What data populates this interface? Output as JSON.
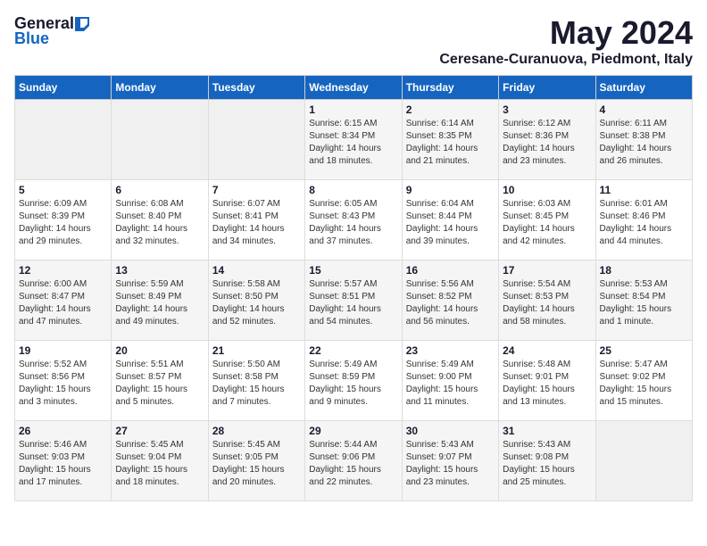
{
  "logo": {
    "general": "General",
    "blue": "Blue"
  },
  "title": "May 2024",
  "location": "Ceresane-Curanuova, Piedmont, Italy",
  "weekdays": [
    "Sunday",
    "Monday",
    "Tuesday",
    "Wednesday",
    "Thursday",
    "Friday",
    "Saturday"
  ],
  "weeks": [
    [
      {
        "day": null,
        "info": ""
      },
      {
        "day": null,
        "info": ""
      },
      {
        "day": null,
        "info": ""
      },
      {
        "day": "1",
        "info": "Sunrise: 6:15 AM\nSunset: 8:34 PM\nDaylight: 14 hours and 18 minutes."
      },
      {
        "day": "2",
        "info": "Sunrise: 6:14 AM\nSunset: 8:35 PM\nDaylight: 14 hours and 21 minutes."
      },
      {
        "day": "3",
        "info": "Sunrise: 6:12 AM\nSunset: 8:36 PM\nDaylight: 14 hours and 23 minutes."
      },
      {
        "day": "4",
        "info": "Sunrise: 6:11 AM\nSunset: 8:38 PM\nDaylight: 14 hours and 26 minutes."
      }
    ],
    [
      {
        "day": "5",
        "info": "Sunrise: 6:09 AM\nSunset: 8:39 PM\nDaylight: 14 hours and 29 minutes."
      },
      {
        "day": "6",
        "info": "Sunrise: 6:08 AM\nSunset: 8:40 PM\nDaylight: 14 hours and 32 minutes."
      },
      {
        "day": "7",
        "info": "Sunrise: 6:07 AM\nSunset: 8:41 PM\nDaylight: 14 hours and 34 minutes."
      },
      {
        "day": "8",
        "info": "Sunrise: 6:05 AM\nSunset: 8:43 PM\nDaylight: 14 hours and 37 minutes."
      },
      {
        "day": "9",
        "info": "Sunrise: 6:04 AM\nSunset: 8:44 PM\nDaylight: 14 hours and 39 minutes."
      },
      {
        "day": "10",
        "info": "Sunrise: 6:03 AM\nSunset: 8:45 PM\nDaylight: 14 hours and 42 minutes."
      },
      {
        "day": "11",
        "info": "Sunrise: 6:01 AM\nSunset: 8:46 PM\nDaylight: 14 hours and 44 minutes."
      }
    ],
    [
      {
        "day": "12",
        "info": "Sunrise: 6:00 AM\nSunset: 8:47 PM\nDaylight: 14 hours and 47 minutes."
      },
      {
        "day": "13",
        "info": "Sunrise: 5:59 AM\nSunset: 8:49 PM\nDaylight: 14 hours and 49 minutes."
      },
      {
        "day": "14",
        "info": "Sunrise: 5:58 AM\nSunset: 8:50 PM\nDaylight: 14 hours and 52 minutes."
      },
      {
        "day": "15",
        "info": "Sunrise: 5:57 AM\nSunset: 8:51 PM\nDaylight: 14 hours and 54 minutes."
      },
      {
        "day": "16",
        "info": "Sunrise: 5:56 AM\nSunset: 8:52 PM\nDaylight: 14 hours and 56 minutes."
      },
      {
        "day": "17",
        "info": "Sunrise: 5:54 AM\nSunset: 8:53 PM\nDaylight: 14 hours and 58 minutes."
      },
      {
        "day": "18",
        "info": "Sunrise: 5:53 AM\nSunset: 8:54 PM\nDaylight: 15 hours and 1 minute."
      }
    ],
    [
      {
        "day": "19",
        "info": "Sunrise: 5:52 AM\nSunset: 8:56 PM\nDaylight: 15 hours and 3 minutes."
      },
      {
        "day": "20",
        "info": "Sunrise: 5:51 AM\nSunset: 8:57 PM\nDaylight: 15 hours and 5 minutes."
      },
      {
        "day": "21",
        "info": "Sunrise: 5:50 AM\nSunset: 8:58 PM\nDaylight: 15 hours and 7 minutes."
      },
      {
        "day": "22",
        "info": "Sunrise: 5:49 AM\nSunset: 8:59 PM\nDaylight: 15 hours and 9 minutes."
      },
      {
        "day": "23",
        "info": "Sunrise: 5:49 AM\nSunset: 9:00 PM\nDaylight: 15 hours and 11 minutes."
      },
      {
        "day": "24",
        "info": "Sunrise: 5:48 AM\nSunset: 9:01 PM\nDaylight: 15 hours and 13 minutes."
      },
      {
        "day": "25",
        "info": "Sunrise: 5:47 AM\nSunset: 9:02 PM\nDaylight: 15 hours and 15 minutes."
      }
    ],
    [
      {
        "day": "26",
        "info": "Sunrise: 5:46 AM\nSunset: 9:03 PM\nDaylight: 15 hours and 17 minutes."
      },
      {
        "day": "27",
        "info": "Sunrise: 5:45 AM\nSunset: 9:04 PM\nDaylight: 15 hours and 18 minutes."
      },
      {
        "day": "28",
        "info": "Sunrise: 5:45 AM\nSunset: 9:05 PM\nDaylight: 15 hours and 20 minutes."
      },
      {
        "day": "29",
        "info": "Sunrise: 5:44 AM\nSunset: 9:06 PM\nDaylight: 15 hours and 22 minutes."
      },
      {
        "day": "30",
        "info": "Sunrise: 5:43 AM\nSunset: 9:07 PM\nDaylight: 15 hours and 23 minutes."
      },
      {
        "day": "31",
        "info": "Sunrise: 5:43 AM\nSunset: 9:08 PM\nDaylight: 15 hours and 25 minutes."
      },
      {
        "day": null,
        "info": ""
      }
    ]
  ]
}
